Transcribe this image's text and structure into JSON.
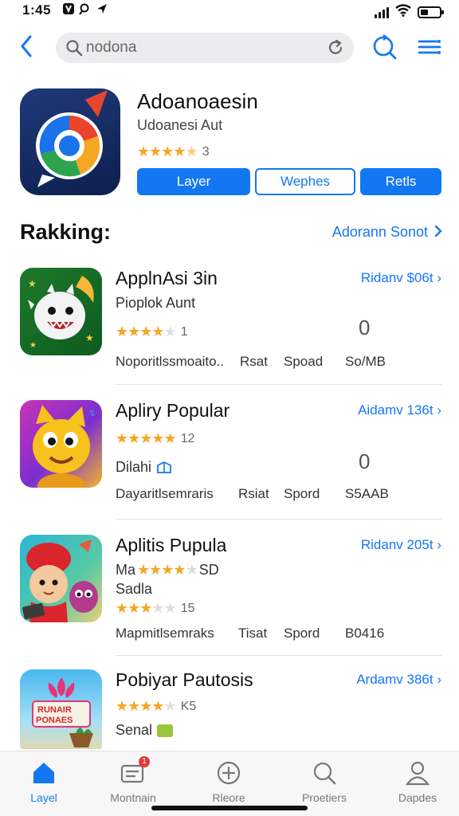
{
  "status": {
    "time": "1:45"
  },
  "search": {
    "value": "nodona"
  },
  "hero": {
    "title": "Adoanoaesin",
    "subtitle": "Udoanesi Aut",
    "rating_stars": 4.5,
    "rating_count": "3",
    "buttons": [
      "Layer",
      "Wephes",
      "Retls"
    ]
  },
  "ranking": {
    "title": "Rakking:",
    "link": "Adorann Sonot"
  },
  "apps": [
    {
      "name": "ApplnAsi 3in",
      "price": "Ridanv $06t",
      "line2": "Pioplok Aunt",
      "stars": 4,
      "rating_count": "1",
      "zero": "0",
      "meta": [
        "Noporitlssmoaito..",
        "Rsat",
        "Spoad",
        "So/MB"
      ]
    },
    {
      "name": "Apliry Popular",
      "price": "Aidamv 136t",
      "stars": 5,
      "rating_count": "12",
      "line3_text": "Dilahi",
      "zero": "0",
      "meta": [
        "Dayaritlsemraris",
        "Rsiat",
        "Spord",
        "S5AAB"
      ]
    },
    {
      "name": "Aplitis Pupula",
      "price": "Ridanv 205t",
      "line2_prefix": "Ma",
      "line2_stars": 4,
      "line2_suffix": "SD",
      "line3_text": "Sadla",
      "stars": 3,
      "rating_count": "15",
      "meta": [
        "Mapmitlsemraks",
        "Tisat",
        "Spord",
        "B0416"
      ]
    },
    {
      "name": "Pobiyar Pautosis",
      "price": "Ardamv 386t",
      "stars": 4,
      "rating_count": "K5",
      "line3_text": "Senal"
    }
  ],
  "tabs": [
    {
      "label": "Layel",
      "icon": "home-icon",
      "active": true
    },
    {
      "label": "Montnain",
      "icon": "mail-icon",
      "badge": "1"
    },
    {
      "label": "Rleore",
      "icon": "add-circle-icon"
    },
    {
      "label": "Proetiers",
      "icon": "search-icon"
    },
    {
      "label": "Dapdes",
      "icon": "person-icon"
    }
  ],
  "colors": {
    "accent": "#1477f2",
    "star": "#f5a623"
  }
}
